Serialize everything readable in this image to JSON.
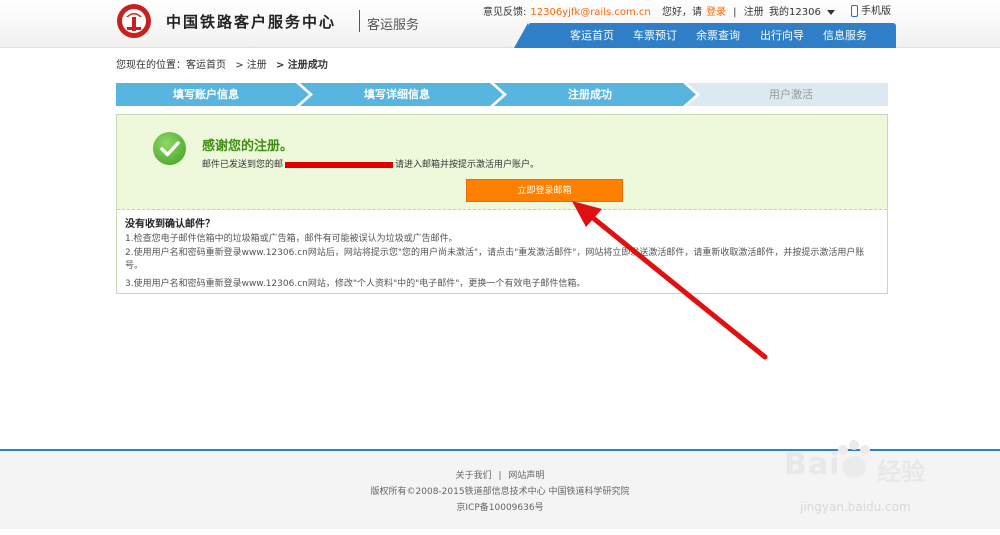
{
  "header": {
    "logo_text": "中国铁路客户服务中心",
    "logo_sub": "客运服务",
    "feedback_label": "意见反馈:",
    "feedback_email": "12306yjfk@rails.com.cn",
    "greeting": "您好，请",
    "login": "登录",
    "register": "注册",
    "my_account": "我的12306",
    "mobile": "手机版"
  },
  "nav": {
    "items": [
      {
        "label": "客运首页"
      },
      {
        "label": "车票预订"
      },
      {
        "label": "余票查询"
      },
      {
        "label": "出行向导"
      },
      {
        "label": "信息服务"
      }
    ]
  },
  "breadcrumb": {
    "prefix": "您现在的位置：",
    "home": "客运首页",
    "register": "> 注册",
    "current": "> 注册成功"
  },
  "steps": {
    "items": [
      {
        "label": "填写账户信息"
      },
      {
        "label": "填写详细信息"
      },
      {
        "label": "注册成功"
      },
      {
        "label": "用户激活"
      }
    ]
  },
  "success": {
    "title": "感谢您的注册。",
    "mail_prefix": "邮件已发送到您的邮",
    "mail_suffix": "请进入邮箱并按提示激活用户账户。",
    "login_button": "立即登录邮箱"
  },
  "faq": {
    "title": "没有收到确认邮件？",
    "lines": [
      "1.检查您电子邮件信箱中的垃圾箱或广告箱，邮件有可能被误认为垃圾或广告邮件。",
      "2.使用用户名和密码重新登录www.12306.cn网站后，网站将提示您\"您的用户尚未激活\"，请点击\"重发激活邮件\"，网站将立即发送激活邮件，请重新收取激活邮件，并按提示激活用户账号。",
      "3.使用用户名和密码重新登录www.12306.cn网站，修改\"个人资料\"中的\"电子邮件\"，更换一个有效电子邮件信箱。"
    ]
  },
  "footer": {
    "about": "关于我们",
    "statement": "网站声明",
    "copyright": "版权所有©2008-2015铁道部信息技术中心   中国铁道科学研究院",
    "icp": "京ICP备10009636号"
  },
  "watermark": {
    "brand": "Bai",
    "brand_cn": "经验",
    "url": "jingyan.baidu.com"
  },
  "colors": {
    "nav_blue": "#2f7fc8",
    "step_active": "#58b5e0",
    "step_inactive": "#dde9f0",
    "success_green": "#3f8f12",
    "button_orange": "#ff7f00",
    "arrow_red": "#e01010"
  }
}
